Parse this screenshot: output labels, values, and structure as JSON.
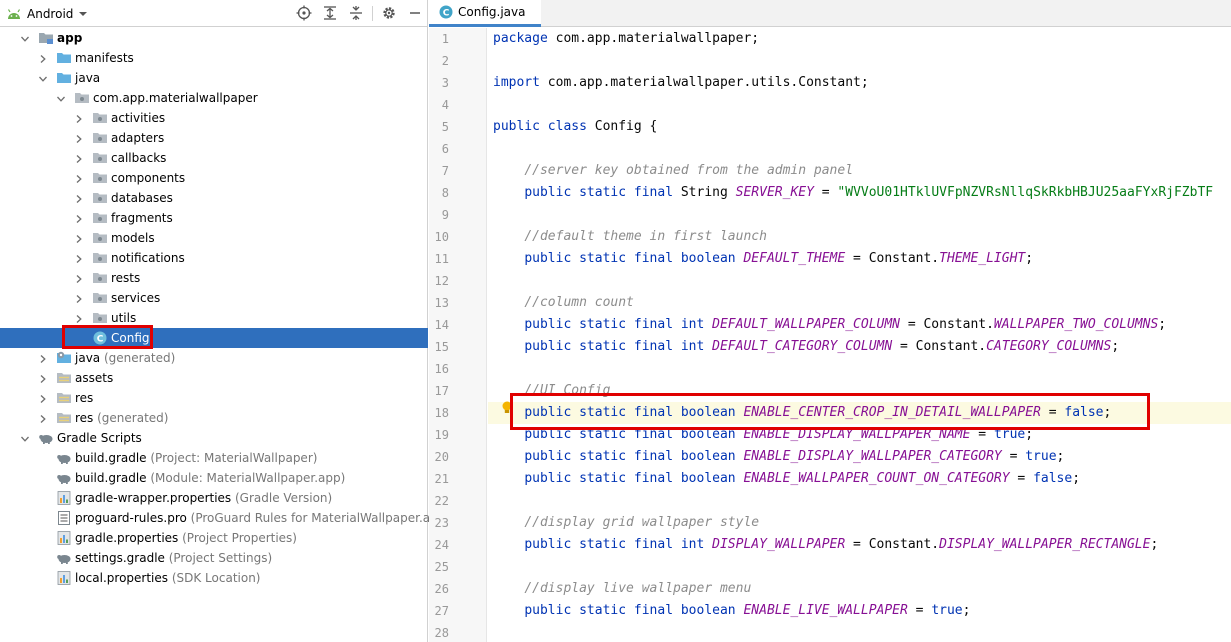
{
  "project_panel": {
    "view_label": "Android",
    "toolbar": {
      "locate_icon": "target-icon",
      "expand_icon": "expand-all-icon",
      "collapse_icon": "collapse-all-icon",
      "settings_icon": "gear-icon",
      "hide_icon": "minimize-icon"
    },
    "tree": [
      {
        "label": "app",
        "hint": "",
        "depth": 0,
        "expanded": true,
        "icon": "module-folder-icon",
        "bold": true
      },
      {
        "label": "manifests",
        "hint": "",
        "depth": 1,
        "expanded": false,
        "icon": "folder-icon"
      },
      {
        "label": "java",
        "hint": "",
        "depth": 1,
        "expanded": true,
        "icon": "folder-icon"
      },
      {
        "label": "com.app.materialwallpaper",
        "hint": "",
        "depth": 2,
        "expanded": true,
        "icon": "package-icon"
      },
      {
        "label": "activities",
        "hint": "",
        "depth": 3,
        "expanded": false,
        "icon": "package-icon"
      },
      {
        "label": "adapters",
        "hint": "",
        "depth": 3,
        "expanded": false,
        "icon": "package-icon"
      },
      {
        "label": "callbacks",
        "hint": "",
        "depth": 3,
        "expanded": false,
        "icon": "package-icon"
      },
      {
        "label": "components",
        "hint": "",
        "depth": 3,
        "expanded": false,
        "icon": "package-icon"
      },
      {
        "label": "databases",
        "hint": "",
        "depth": 3,
        "expanded": false,
        "icon": "package-icon"
      },
      {
        "label": "fragments",
        "hint": "",
        "depth": 3,
        "expanded": false,
        "icon": "package-icon"
      },
      {
        "label": "models",
        "hint": "",
        "depth": 3,
        "expanded": false,
        "icon": "package-icon"
      },
      {
        "label": "notifications",
        "hint": "",
        "depth": 3,
        "expanded": false,
        "icon": "package-icon"
      },
      {
        "label": "rests",
        "hint": "",
        "depth": 3,
        "expanded": false,
        "icon": "package-icon"
      },
      {
        "label": "services",
        "hint": "",
        "depth": 3,
        "expanded": false,
        "icon": "package-icon"
      },
      {
        "label": "utils",
        "hint": "",
        "depth": 3,
        "expanded": false,
        "icon": "package-icon"
      },
      {
        "label": "Config",
        "hint": "",
        "depth": 3,
        "leaf": true,
        "icon": "class-icon",
        "selected": true
      },
      {
        "label": "java",
        "hint": "(generated)",
        "depth": 1,
        "expanded": false,
        "icon": "generated-folder-icon"
      },
      {
        "label": "assets",
        "hint": "",
        "depth": 1,
        "expanded": false,
        "icon": "resource-folder-icon"
      },
      {
        "label": "res",
        "hint": "",
        "depth": 1,
        "expanded": false,
        "icon": "resource-folder-icon"
      },
      {
        "label": "res",
        "hint": "(generated)",
        "depth": 1,
        "expanded": false,
        "icon": "resource-folder-icon"
      },
      {
        "label": "Gradle Scripts",
        "hint": "",
        "depth": 0,
        "expanded": true,
        "icon": "gradle-icon"
      },
      {
        "label": "build.gradle",
        "hint": "(Project: MaterialWallpaper)",
        "depth": 1,
        "leaf": true,
        "icon": "gradle-icon"
      },
      {
        "label": "build.gradle",
        "hint": "(Module: MaterialWallpaper.app)",
        "depth": 1,
        "leaf": true,
        "icon": "gradle-icon"
      },
      {
        "label": "gradle-wrapper.properties",
        "hint": "(Gradle Version)",
        "depth": 1,
        "leaf": true,
        "icon": "properties-icon"
      },
      {
        "label": "proguard-rules.pro",
        "hint": "(ProGuard Rules for MaterialWallpaper.app)",
        "depth": 1,
        "leaf": true,
        "icon": "text-file-icon"
      },
      {
        "label": "gradle.properties",
        "hint": "(Project Properties)",
        "depth": 1,
        "leaf": true,
        "icon": "properties-icon"
      },
      {
        "label": "settings.gradle",
        "hint": "(Project Settings)",
        "depth": 1,
        "leaf": true,
        "icon": "gradle-icon"
      },
      {
        "label": "local.properties",
        "hint": "(SDK Location)",
        "depth": 1,
        "leaf": true,
        "icon": "properties-icon"
      }
    ]
  },
  "editor": {
    "tab_label": "Config.java",
    "caret_line": 18,
    "lines": [
      [
        [
          "kw",
          "package"
        ],
        [
          "t",
          " com.app.materialwallpaper;"
        ]
      ],
      [],
      [
        [
          "kw",
          "import"
        ],
        [
          "t",
          " com.app.materialwallpaper.utils.Constant;"
        ]
      ],
      [],
      [
        [
          "kw",
          "public class"
        ],
        [
          "t",
          " Config {"
        ]
      ],
      [],
      [
        [
          "t",
          "    "
        ],
        [
          "cmt",
          "//server key obtained from the admin panel"
        ]
      ],
      [
        [
          "t",
          "    "
        ],
        [
          "kw",
          "public static final"
        ],
        [
          "t",
          " String "
        ],
        [
          "fld",
          "SERVER_KEY"
        ],
        [
          "t",
          " = "
        ],
        [
          "str",
          "\"WVVoU01HTklUVFpNZVRsNllqSkRkbHBJU25aaFYxRjFZbTF"
        ]
      ],
      [],
      [
        [
          "t",
          "    "
        ],
        [
          "cmt",
          "//default theme in first launch"
        ]
      ],
      [
        [
          "t",
          "    "
        ],
        [
          "kw",
          "public static final boolean"
        ],
        [
          "t",
          " "
        ],
        [
          "fld",
          "DEFAULT_THEME"
        ],
        [
          "t",
          " = Constant."
        ],
        [
          "fld",
          "THEME_LIGHT"
        ],
        [
          "t",
          ";"
        ]
      ],
      [],
      [
        [
          "t",
          "    "
        ],
        [
          "cmt",
          "//column count"
        ]
      ],
      [
        [
          "t",
          "    "
        ],
        [
          "kw",
          "public static final int"
        ],
        [
          "t",
          " "
        ],
        [
          "fld",
          "DEFAULT_WALLPAPER_COLUMN"
        ],
        [
          "t",
          " = Constant."
        ],
        [
          "fld",
          "WALLPAPER_TWO_COLUMNS"
        ],
        [
          "t",
          ";"
        ]
      ],
      [
        [
          "t",
          "    "
        ],
        [
          "kw",
          "public static final int"
        ],
        [
          "t",
          " "
        ],
        [
          "fld",
          "DEFAULT_CATEGORY_COLUMN"
        ],
        [
          "t",
          " = Constant."
        ],
        [
          "fld",
          "CATEGORY_COLUMNS"
        ],
        [
          "t",
          ";"
        ]
      ],
      [],
      [
        [
          "t",
          "    "
        ],
        [
          "cmt",
          "//UI Config"
        ]
      ],
      [
        [
          "t",
          "    "
        ],
        [
          "kw",
          "public static final boolean"
        ],
        [
          "t",
          " "
        ],
        [
          "fld",
          "ENABLE_CENTER_CROP_IN_DETAIL_WALLPAPER"
        ],
        [
          "t",
          " = "
        ],
        [
          "kw",
          "false"
        ],
        [
          "t",
          ";"
        ]
      ],
      [
        [
          "t",
          "    "
        ],
        [
          "kw",
          "public static final boolean"
        ],
        [
          "t",
          " "
        ],
        [
          "fld",
          "ENABLE_DISPLAY_WALLPAPER_NAME"
        ],
        [
          "t",
          " = "
        ],
        [
          "kw",
          "true"
        ],
        [
          "t",
          ";"
        ]
      ],
      [
        [
          "t",
          "    "
        ],
        [
          "kw",
          "public static final boolean"
        ],
        [
          "t",
          " "
        ],
        [
          "fld",
          "ENABLE_DISPLAY_WALLPAPER_CATEGORY"
        ],
        [
          "t",
          " = "
        ],
        [
          "kw",
          "true"
        ],
        [
          "t",
          ";"
        ]
      ],
      [
        [
          "t",
          "    "
        ],
        [
          "kw",
          "public static final boolean"
        ],
        [
          "t",
          " "
        ],
        [
          "fld",
          "ENABLE_WALLPAPER_COUNT_ON_CATEGORY"
        ],
        [
          "t",
          " = "
        ],
        [
          "kw",
          "false"
        ],
        [
          "t",
          ";"
        ]
      ],
      [],
      [
        [
          "t",
          "    "
        ],
        [
          "cmt",
          "//display grid wallpaper style"
        ]
      ],
      [
        [
          "t",
          "    "
        ],
        [
          "kw",
          "public static final int"
        ],
        [
          "t",
          " "
        ],
        [
          "fld",
          "DISPLAY_WALLPAPER"
        ],
        [
          "t",
          " = Constant."
        ],
        [
          "fld",
          "DISPLAY_WALLPAPER_RECTANGLE"
        ],
        [
          "t",
          ";"
        ]
      ],
      [],
      [
        [
          "t",
          "    "
        ],
        [
          "cmt",
          "//display live wallpaper menu"
        ]
      ],
      [
        [
          "t",
          "    "
        ],
        [
          "kw",
          "public static final boolean"
        ],
        [
          "t",
          " "
        ],
        [
          "fld",
          "ENABLE_LIVE_WALLPAPER"
        ],
        [
          "t",
          " = "
        ],
        [
          "kw",
          "true"
        ],
        [
          "t",
          ";"
        ]
      ],
      []
    ]
  },
  "colors": {
    "selection": "#2f6fbd",
    "annotation_red": "#e00000",
    "keyword": "#0033b3",
    "field": "#871094",
    "string": "#067d17",
    "comment": "#8c8c8c"
  }
}
